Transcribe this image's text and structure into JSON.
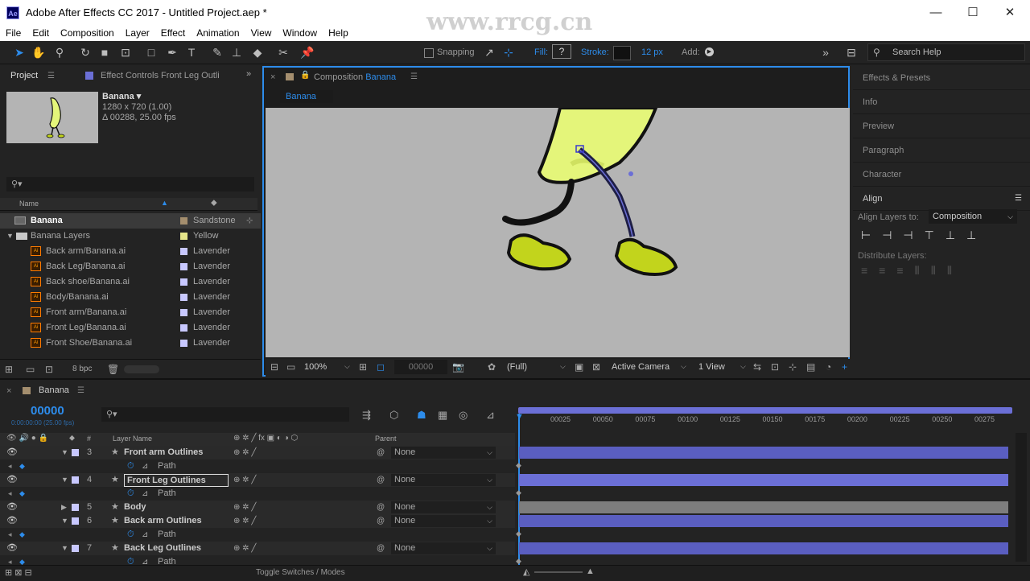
{
  "window": {
    "title": "Adobe After Effects CC 2017 - Untitled Project.aep *",
    "logo": "Ae",
    "minimize": "—",
    "maximize": "☐",
    "close": "✕"
  },
  "menu": [
    "File",
    "Edit",
    "Composition",
    "Layer",
    "Effect",
    "Animation",
    "View",
    "Window",
    "Help"
  ],
  "watermark_url": "www.rrcg.cn",
  "toolbar": {
    "snapping": "Snapping",
    "fill_label": "Fill:",
    "fill_value": "?",
    "stroke_label": "Stroke:",
    "stroke_width": "12 px",
    "add_label": "Add:",
    "search_help": "Search Help"
  },
  "project": {
    "tab": "Project",
    "effect_controls_tab": "Effect Controls Front Leg Outli",
    "item_name": "Banana ▾",
    "item_dims": "1280 x 720 (1.00)",
    "item_duration": "Δ 00288, 25.00 fps",
    "col_name": "Name",
    "bpc": "8 bpc",
    "items": [
      {
        "name": "Banana",
        "label": "Sandstone",
        "color": "#a48e6e",
        "kind": "comp"
      },
      {
        "name": "Banana Layers",
        "label": "Yellow",
        "color": "#e5e58a",
        "kind": "folder"
      },
      {
        "name": "Back arm/Banana.ai",
        "label": "Lavender",
        "color": "#c8c8ff",
        "kind": "ai"
      },
      {
        "name": "Back Leg/Banana.ai",
        "label": "Lavender",
        "color": "#c8c8ff",
        "kind": "ai"
      },
      {
        "name": "Back shoe/Banana.ai",
        "label": "Lavender",
        "color": "#c8c8ff",
        "kind": "ai"
      },
      {
        "name": "Body/Banana.ai",
        "label": "Lavender",
        "color": "#c8c8ff",
        "kind": "ai"
      },
      {
        "name": "Front arm/Banana.ai",
        "label": "Lavender",
        "color": "#c8c8ff",
        "kind": "ai"
      },
      {
        "name": "Front Leg/Banana.ai",
        "label": "Lavender",
        "color": "#c8c8ff",
        "kind": "ai"
      },
      {
        "name": "Front Shoe/Banana.ai",
        "label": "Lavender",
        "color": "#c8c8ff",
        "kind": "ai"
      }
    ]
  },
  "composition": {
    "tab_prefix": "Composition",
    "tab_name": "Banana",
    "subtab": "Banana",
    "zoom": "100%",
    "timecode": "00000",
    "resolution": "(Full)",
    "camera": "Active Camera",
    "views": "1 View"
  },
  "right_panel": {
    "items": [
      "Effects & Presets",
      "Info",
      "Preview",
      "Paragraph",
      "Character"
    ],
    "align_title": "Align",
    "align_to_label": "Align Layers to:",
    "align_to_value": "Composition",
    "distribute_label": "Distribute Layers:"
  },
  "timeline": {
    "tab": "Banana",
    "current_time": "00000",
    "sub_time": "0:00:00:00 (25.00 fps)",
    "col_layer_name": "Layer Name",
    "col_parent": "Parent",
    "ruler": [
      "00025",
      "00050",
      "00075",
      "00100",
      "00125",
      "00150",
      "00175",
      "00200",
      "00225",
      "00250",
      "00275"
    ],
    "toggle_label": "Toggle Switches / Modes",
    "rows": [
      {
        "type": "layer",
        "num": "3",
        "name": "Front arm Outlines",
        "parent": "None",
        "cut": true
      },
      {
        "type": "prop",
        "name": "Path"
      },
      {
        "type": "layer",
        "num": "4",
        "name": "Front Leg Outlines",
        "parent": "None",
        "selected": true
      },
      {
        "type": "prop",
        "name": "Path"
      },
      {
        "type": "layer",
        "num": "5",
        "name": "Body",
        "parent": "None",
        "collapsed": true
      },
      {
        "type": "layer",
        "num": "6",
        "name": "Back arm Outlines",
        "parent": "None"
      },
      {
        "type": "prop",
        "name": "Path"
      },
      {
        "type": "layer",
        "num": "7",
        "name": "Back Leg Outlines",
        "parent": "None"
      },
      {
        "type": "prop",
        "name": "Path"
      }
    ]
  },
  "colors": {
    "accent": "#2d8ceb",
    "layer_bar": "#6b6fd6",
    "viewer_bg": "#b4b4b4",
    "banana": "#e4f57a",
    "shoe": "#c2d41c"
  }
}
